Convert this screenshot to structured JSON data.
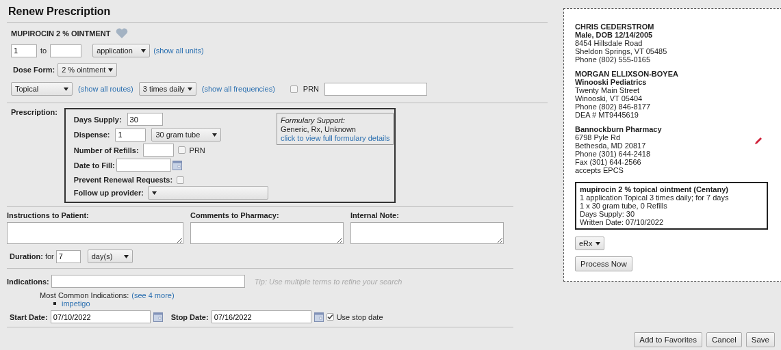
{
  "title": "Renew Prescription",
  "drug": {
    "name": "MUPIROCIN 2 % OINTMENT"
  },
  "dose": {
    "from": "1",
    "to_label": "to",
    "unit": "application",
    "unit_link": "(show all units)"
  },
  "dose_form": {
    "label": "Dose Form:",
    "value": "2 % ointment"
  },
  "route": {
    "value": "Topical",
    "route_link": "(show all routes)",
    "frequency": "3 times daily",
    "frequency_link": "(show all frequencies)",
    "prn_label": "PRN",
    "prn_checked": false
  },
  "prescription": {
    "label": "Prescription:",
    "days_supply_label": "Days Supply:",
    "days_supply": "30",
    "dispense_label": "Dispense:",
    "dispense": "1",
    "package": "30 gram tube",
    "refills_label": "Number of Refills:",
    "refills_prn_label": "PRN",
    "refills_prn_checked": false,
    "date_label": "Date to Fill:",
    "prevent_label": "Prevent Renewal Requests:",
    "prevent_checked": false,
    "followup_label": "Follow up provider:",
    "formulary": {
      "title": "Formulary Support:",
      "status": "Generic, Rx, Unknown",
      "link": "click to view full formulary details"
    }
  },
  "notes": [
    {
      "label": "Instructions to Patient:"
    },
    {
      "label": "Comments to Pharmacy:"
    },
    {
      "label": "Internal Note:"
    }
  ],
  "duration": {
    "label": "Duration:",
    "for_label": "for",
    "value": "7",
    "unit": "day(s)"
  },
  "indications": {
    "label": "Indications:",
    "tip": "Tip: Use multiple terms to refine your search",
    "common_label": "Most Common Indications:",
    "more_link": "(see 4 more)",
    "items": [
      "impetigo"
    ]
  },
  "dates": {
    "start_label": "Start Date:",
    "start": "07/10/2022",
    "stop_label": "Stop Date:",
    "stop": "07/16/2022",
    "use_stop_label": "Use stop date",
    "use_stop_checked": true
  },
  "summary": {
    "patient": {
      "name": "CHRIS CEDERSTROM",
      "details": "Male, DOB 12/14/2005",
      "lines": [
        "8454 Hillsdale Road",
        "Sheldon Springs, VT 05485",
        "Phone (802) 555-0165"
      ]
    },
    "prescriber": {
      "name": "MORGAN ELLIXSON-BOYEA",
      "practice": "Winooski Pediatrics",
      "lines": [
        "Twenty Main Street",
        "Winooski, VT 05404",
        "Phone (802) 846-8177",
        "DEA # MT9445619"
      ]
    },
    "pharmacy": {
      "name": "Bannockburn Pharmacy",
      "lines": [
        "6798 Pyle Rd",
        "Bethesda, MD 20817",
        "Phone (301) 644-2418",
        "Fax (301) 644-2566",
        "accepts EPCS"
      ]
    },
    "rx": {
      "title": "mupirocin 2 % topical ointment (Centany)",
      "lines": [
        "1 application Topical 3 times daily; for 7 days",
        "1 x 30 gram tube, 0 Refills",
        "Days Supply: 30",
        "Written Date: 07/10/2022"
      ]
    },
    "method": "eRx",
    "process_button": "Process Now"
  },
  "buttons": [
    "Add to Favorites",
    "Cancel",
    "Save"
  ]
}
